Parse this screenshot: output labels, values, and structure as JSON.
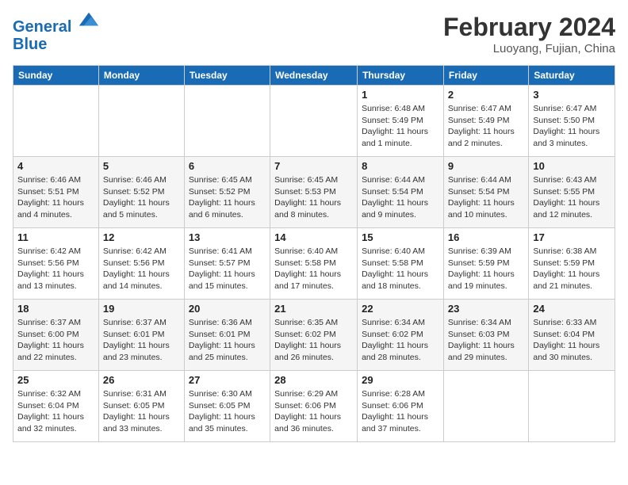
{
  "header": {
    "logo_line1": "General",
    "logo_line2": "Blue",
    "month": "February 2024",
    "location": "Luoyang, Fujian, China"
  },
  "weekdays": [
    "Sunday",
    "Monday",
    "Tuesday",
    "Wednesday",
    "Thursday",
    "Friday",
    "Saturday"
  ],
  "weeks": [
    [
      {
        "day": "",
        "detail": ""
      },
      {
        "day": "",
        "detail": ""
      },
      {
        "day": "",
        "detail": ""
      },
      {
        "day": "",
        "detail": ""
      },
      {
        "day": "1",
        "detail": "Sunrise: 6:48 AM\nSunset: 5:49 PM\nDaylight: 11 hours and 1 minute."
      },
      {
        "day": "2",
        "detail": "Sunrise: 6:47 AM\nSunset: 5:49 PM\nDaylight: 11 hours and 2 minutes."
      },
      {
        "day": "3",
        "detail": "Sunrise: 6:47 AM\nSunset: 5:50 PM\nDaylight: 11 hours and 3 minutes."
      }
    ],
    [
      {
        "day": "4",
        "detail": "Sunrise: 6:46 AM\nSunset: 5:51 PM\nDaylight: 11 hours and 4 minutes."
      },
      {
        "day": "5",
        "detail": "Sunrise: 6:46 AM\nSunset: 5:52 PM\nDaylight: 11 hours and 5 minutes."
      },
      {
        "day": "6",
        "detail": "Sunrise: 6:45 AM\nSunset: 5:52 PM\nDaylight: 11 hours and 6 minutes."
      },
      {
        "day": "7",
        "detail": "Sunrise: 6:45 AM\nSunset: 5:53 PM\nDaylight: 11 hours and 8 minutes."
      },
      {
        "day": "8",
        "detail": "Sunrise: 6:44 AM\nSunset: 5:54 PM\nDaylight: 11 hours and 9 minutes."
      },
      {
        "day": "9",
        "detail": "Sunrise: 6:44 AM\nSunset: 5:54 PM\nDaylight: 11 hours and 10 minutes."
      },
      {
        "day": "10",
        "detail": "Sunrise: 6:43 AM\nSunset: 5:55 PM\nDaylight: 11 hours and 12 minutes."
      }
    ],
    [
      {
        "day": "11",
        "detail": "Sunrise: 6:42 AM\nSunset: 5:56 PM\nDaylight: 11 hours and 13 minutes."
      },
      {
        "day": "12",
        "detail": "Sunrise: 6:42 AM\nSunset: 5:56 PM\nDaylight: 11 hours and 14 minutes."
      },
      {
        "day": "13",
        "detail": "Sunrise: 6:41 AM\nSunset: 5:57 PM\nDaylight: 11 hours and 15 minutes."
      },
      {
        "day": "14",
        "detail": "Sunrise: 6:40 AM\nSunset: 5:58 PM\nDaylight: 11 hours and 17 minutes."
      },
      {
        "day": "15",
        "detail": "Sunrise: 6:40 AM\nSunset: 5:58 PM\nDaylight: 11 hours and 18 minutes."
      },
      {
        "day": "16",
        "detail": "Sunrise: 6:39 AM\nSunset: 5:59 PM\nDaylight: 11 hours and 19 minutes."
      },
      {
        "day": "17",
        "detail": "Sunrise: 6:38 AM\nSunset: 5:59 PM\nDaylight: 11 hours and 21 minutes."
      }
    ],
    [
      {
        "day": "18",
        "detail": "Sunrise: 6:37 AM\nSunset: 6:00 PM\nDaylight: 11 hours and 22 minutes."
      },
      {
        "day": "19",
        "detail": "Sunrise: 6:37 AM\nSunset: 6:01 PM\nDaylight: 11 hours and 23 minutes."
      },
      {
        "day": "20",
        "detail": "Sunrise: 6:36 AM\nSunset: 6:01 PM\nDaylight: 11 hours and 25 minutes."
      },
      {
        "day": "21",
        "detail": "Sunrise: 6:35 AM\nSunset: 6:02 PM\nDaylight: 11 hours and 26 minutes."
      },
      {
        "day": "22",
        "detail": "Sunrise: 6:34 AM\nSunset: 6:02 PM\nDaylight: 11 hours and 28 minutes."
      },
      {
        "day": "23",
        "detail": "Sunrise: 6:34 AM\nSunset: 6:03 PM\nDaylight: 11 hours and 29 minutes."
      },
      {
        "day": "24",
        "detail": "Sunrise: 6:33 AM\nSunset: 6:04 PM\nDaylight: 11 hours and 30 minutes."
      }
    ],
    [
      {
        "day": "25",
        "detail": "Sunrise: 6:32 AM\nSunset: 6:04 PM\nDaylight: 11 hours and 32 minutes."
      },
      {
        "day": "26",
        "detail": "Sunrise: 6:31 AM\nSunset: 6:05 PM\nDaylight: 11 hours and 33 minutes."
      },
      {
        "day": "27",
        "detail": "Sunrise: 6:30 AM\nSunset: 6:05 PM\nDaylight: 11 hours and 35 minutes."
      },
      {
        "day": "28",
        "detail": "Sunrise: 6:29 AM\nSunset: 6:06 PM\nDaylight: 11 hours and 36 minutes."
      },
      {
        "day": "29",
        "detail": "Sunrise: 6:28 AM\nSunset: 6:06 PM\nDaylight: 11 hours and 37 minutes."
      },
      {
        "day": "",
        "detail": ""
      },
      {
        "day": "",
        "detail": ""
      }
    ]
  ]
}
